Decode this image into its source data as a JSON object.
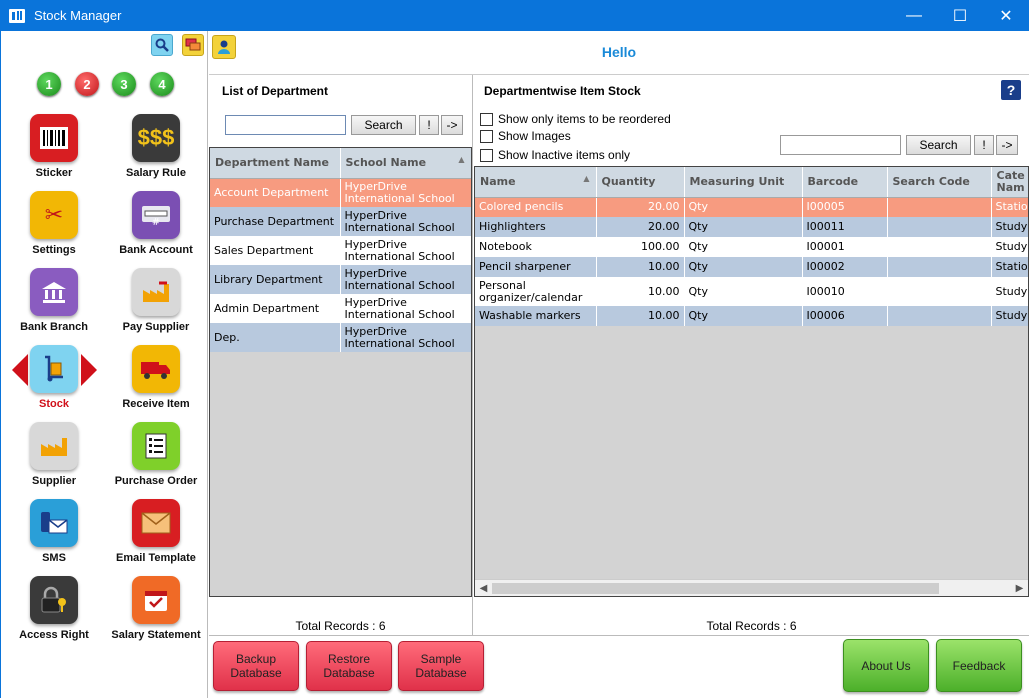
{
  "window": {
    "title": "Stock Manager",
    "minimize": "—",
    "maximize": "☐",
    "close": "✕"
  },
  "sidebar": {
    "numbers": [
      "1",
      "2",
      "3",
      "4"
    ],
    "items": [
      {
        "label": "Sticker",
        "color": "#d81e22"
      },
      {
        "label": "Salary Rule",
        "color": "#3a3a3a"
      },
      {
        "label": "Settings",
        "color": "#f2b705"
      },
      {
        "label": "Bank Account",
        "color": "#7b4fb3"
      },
      {
        "label": "Bank Branch",
        "color": "#8a5cc0"
      },
      {
        "label": "Pay Supplier",
        "color": "#d8d8d8"
      },
      {
        "label": "Stock",
        "color": "#7fd3f0"
      },
      {
        "label": "Receive Item",
        "color": "#f2b705"
      },
      {
        "label": "Supplier",
        "color": "#d8d8d8"
      },
      {
        "label": "Purchase Order",
        "color": "#7fd02a"
      },
      {
        "label": "SMS",
        "color": "#2a9fd8"
      },
      {
        "label": "Email Template",
        "color": "#d81e22"
      },
      {
        "label": "Access Right",
        "color": "#3a3a3a"
      },
      {
        "label": "Salary Statement",
        "color": "#f06a26"
      }
    ]
  },
  "header": {
    "greeting": "Hello"
  },
  "department": {
    "title": "List of Department",
    "search_value": "",
    "search_label": "Search",
    "bang_label": "!",
    "go_label": "->",
    "columns": [
      "Department Name",
      "School Name"
    ],
    "rows": [
      {
        "name": "Account Department",
        "school": "HyperDrive International School"
      },
      {
        "name": "Purchase Department",
        "school": "HyperDrive International School"
      },
      {
        "name": "Sales Department",
        "school": "HyperDrive International School"
      },
      {
        "name": "Library Department",
        "school": "HyperDrive International School"
      },
      {
        "name": "Admin Department",
        "school": "HyperDrive International School"
      },
      {
        "name": "Dep.",
        "school": "HyperDrive International School"
      }
    ],
    "total": "Total Records : 6"
  },
  "stock": {
    "title": "Departmentwise Item Stock",
    "help": "?",
    "checks": [
      "Show only items to be reordered",
      "Show Images",
      "Show Inactive items only"
    ],
    "search_value": "",
    "search_label": "Search",
    "bang_label": "!",
    "go_label": "->",
    "columns": [
      "Name",
      "Quantity",
      "Measuring Unit",
      "Barcode",
      "Search Code",
      "Cate Nam"
    ],
    "rows": [
      {
        "name": "Colored pencils",
        "qty": "20.00",
        "unit": "Qty",
        "barcode": "I00005",
        "code": "",
        "cat": "Statio"
      },
      {
        "name": "Highlighters",
        "qty": "20.00",
        "unit": "Qty",
        "barcode": "I00011",
        "code": "",
        "cat": "Study"
      },
      {
        "name": "Notebook",
        "qty": "100.00",
        "unit": "Qty",
        "barcode": "I00001",
        "code": "",
        "cat": "Study"
      },
      {
        "name": "Pencil sharpener",
        "qty": "10.00",
        "unit": "Qty",
        "barcode": "I00002",
        "code": "",
        "cat": "Statio"
      },
      {
        "name": "Personal organizer/calendar",
        "qty": "10.00",
        "unit": "Qty",
        "barcode": "I00010",
        "code": "",
        "cat": "Study"
      },
      {
        "name": "Washable markers",
        "qty": "10.00",
        "unit": "Qty",
        "barcode": "I00006",
        "code": "",
        "cat": "Study"
      }
    ],
    "total": "Total Records : 6"
  },
  "bottom": {
    "backup": "Backup Database",
    "restore": "Restore Database",
    "sample": "Sample Database",
    "about": "About Us",
    "feedback": "Feedback"
  }
}
